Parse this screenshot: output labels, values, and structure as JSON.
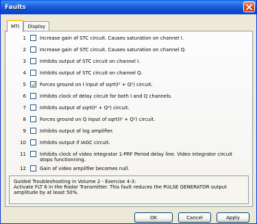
{
  "window": {
    "title": "Faults"
  },
  "tabs": [
    {
      "label": "MTI",
      "active": true
    },
    {
      "label": "Display",
      "active": false
    }
  ],
  "faults": [
    {
      "num": "1",
      "text": "Increase gain of STC circuit. Causes saturation on channel I.",
      "checked": false
    },
    {
      "num": "2",
      "text": "Increase gain of STC circuit. Causes saturation on channel Q.",
      "checked": false
    },
    {
      "num": "3",
      "text": "Inhibits output of STC circuit on channel I.",
      "checked": false
    },
    {
      "num": "4",
      "text": "Inhibits output of STC circuit on channel Q.",
      "checked": false
    },
    {
      "num": "5",
      "text": "Forces ground on I input of sqrt(I² + Q²) circuit.",
      "checked": true
    },
    {
      "num": "6",
      "text": "Inhibits clock of delay circuit for both I and Q channels.",
      "checked": false
    },
    {
      "num": "7",
      "text": "Inhibits output of sqrt(I² + Q²) circuit.",
      "checked": false
    },
    {
      "num": "8",
      "text": "Forces ground on Q input of sqrt(I² + Q²) circuit.",
      "checked": false
    },
    {
      "num": "9",
      "text": "Inhibits output of log amplifier.",
      "checked": false
    },
    {
      "num": "10",
      "text": "Inhibits output if IAGC circuit.",
      "checked": false
    },
    {
      "num": "11",
      "text": "Inhibits clock of video integrator 1-PRF Period delay line. Video integrator circuit stops functionning.",
      "checked": false
    },
    {
      "num": "12",
      "text": "Gain of video amplifier becomes null.",
      "checked": false
    }
  ],
  "info": {
    "line1": "Guided Troubleshooting in Volume 2 - Exercise 4-3:",
    "line2": "Activate FLT 6 in the Radar Transmitter. This fault reduces the PULSE GENERATOR output amplitude by at least 50%."
  },
  "buttons": {
    "ok": "OK",
    "cancel": "Cancel",
    "apply": "Apply"
  }
}
